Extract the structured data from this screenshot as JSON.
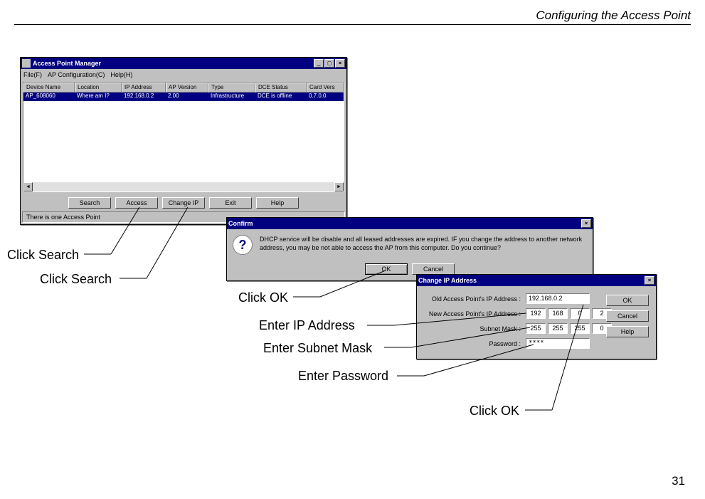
{
  "page": {
    "header": "Configuring the Access Point",
    "number": "31"
  },
  "apm": {
    "title": "Access Point Manager",
    "menu": {
      "file": "File(F)",
      "config": "AP Configuration(C)",
      "help": "Help(H)"
    },
    "columns": {
      "device": "Device Name",
      "location": "Location",
      "ip": "IP Address",
      "version": "AP Version",
      "type": "Type",
      "dce": "DCE Status",
      "card": "Card Vers"
    },
    "row0": {
      "device": "AP_608060",
      "location": "Where am I?",
      "ip": "192.168.0.2",
      "version": "2.00",
      "type": "Infrastructure",
      "dce": "DCE is offline",
      "card": "0.7.0.0"
    },
    "buttons": {
      "search": "Search",
      "access": "Access",
      "changeip": "Change IP",
      "exit": "Exit",
      "help": "Help"
    },
    "status": "There is one Access Point"
  },
  "confirm": {
    "title": "Confirm",
    "text": "DHCP service will be disable and all leased addresses are expired. IF you change the address to another network address, you may be not able to access the AP from this computer. Do you continue?",
    "ok": "OK",
    "cancel": "Cancel"
  },
  "changeip": {
    "title": "Change IP Address",
    "labels": {
      "old": "Old Access Point's IP Address :",
      "new": "New Access Point's IP Address :",
      "mask": "Subnet Mask :",
      "pass": "Password :"
    },
    "old_ip": "192.168.0.2",
    "new_ip": {
      "a": "192",
      "b": "168",
      "c": "0",
      "d": "2"
    },
    "mask": {
      "a": "255",
      "b": "255",
      "c": "255",
      "d": "0"
    },
    "password": "****",
    "buttons": {
      "ok": "OK",
      "cancel": "Cancel",
      "help": "Help"
    }
  },
  "callouts": {
    "click_search1": "Click Search",
    "click_search2": "Click Search",
    "click_ok1": "Click OK",
    "enter_ip": "Enter IP Address",
    "enter_mask": "Enter Subnet Mask",
    "enter_pass": "Enter Password",
    "click_ok2": "Click OK"
  }
}
